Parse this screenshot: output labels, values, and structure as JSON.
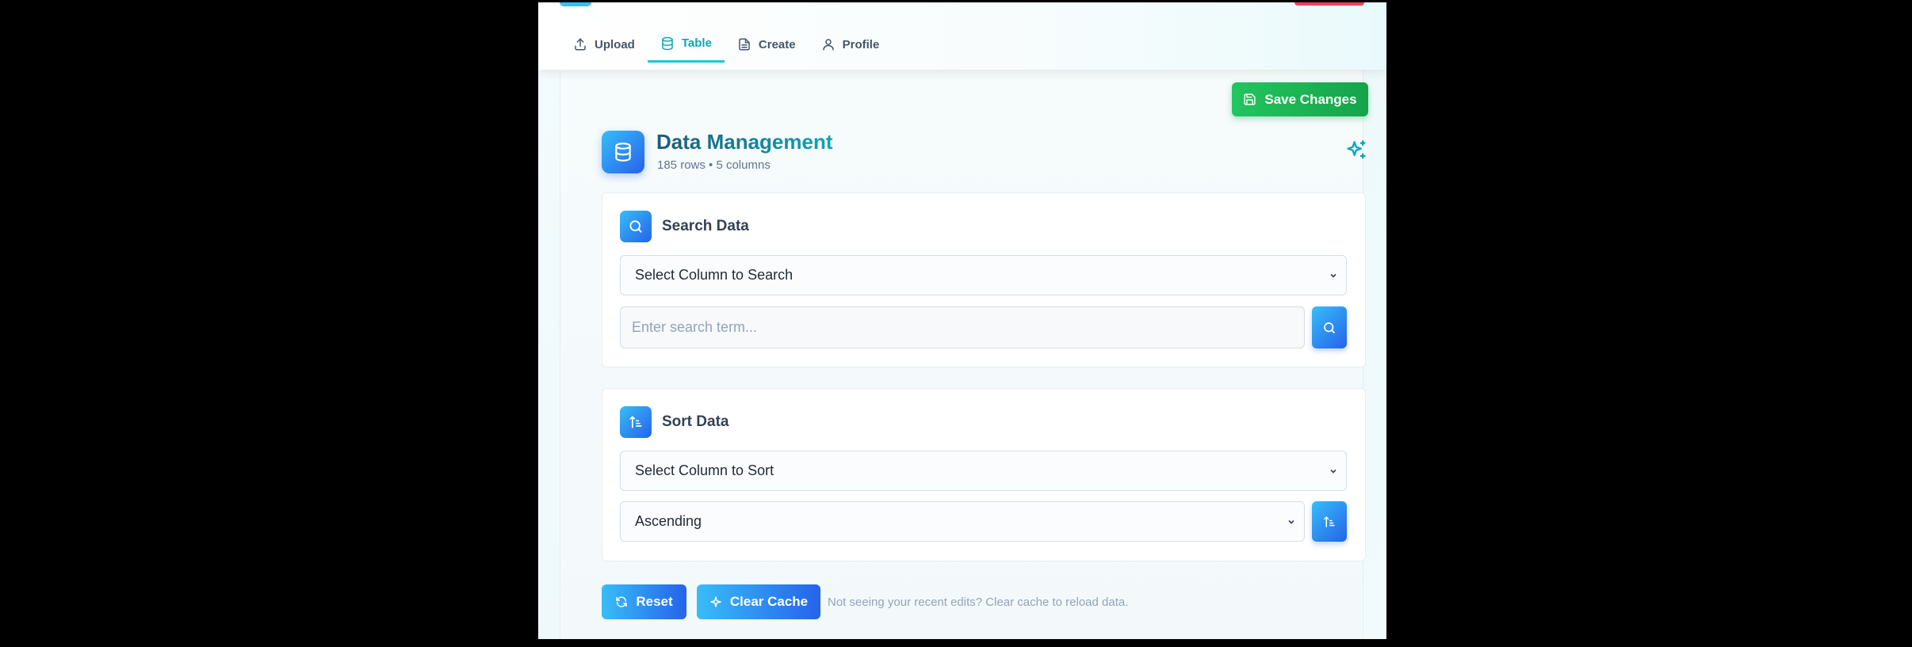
{
  "nav": {
    "tabs": [
      {
        "label": "Upload",
        "icon": "upload-icon",
        "active": false
      },
      {
        "label": "Table",
        "icon": "database-icon",
        "active": true
      },
      {
        "label": "Create",
        "icon": "file-icon",
        "active": false
      },
      {
        "label": "Profile",
        "icon": "user-icon",
        "active": false
      }
    ]
  },
  "toolbar": {
    "save_label": "Save Changes"
  },
  "header": {
    "title": "Data Management",
    "subtitle": "185 rows • 5 columns"
  },
  "search": {
    "title": "Search Data",
    "column_select": "Select Column to Search",
    "placeholder": "Enter search term..."
  },
  "sort": {
    "title": "Sort Data",
    "column_select": "Select Column to Sort",
    "order_select": "Ascending"
  },
  "actions": {
    "reset_label": "Reset",
    "clear_cache_label": "Clear Cache",
    "hint": "Not seeing your recent edits? Clear cache to reload data."
  },
  "colors": {
    "accent": "#0ea5b7",
    "primary_gradient_start": "#38bdf8",
    "primary_gradient_end": "#2563eb",
    "save_green": "#22c55e"
  }
}
